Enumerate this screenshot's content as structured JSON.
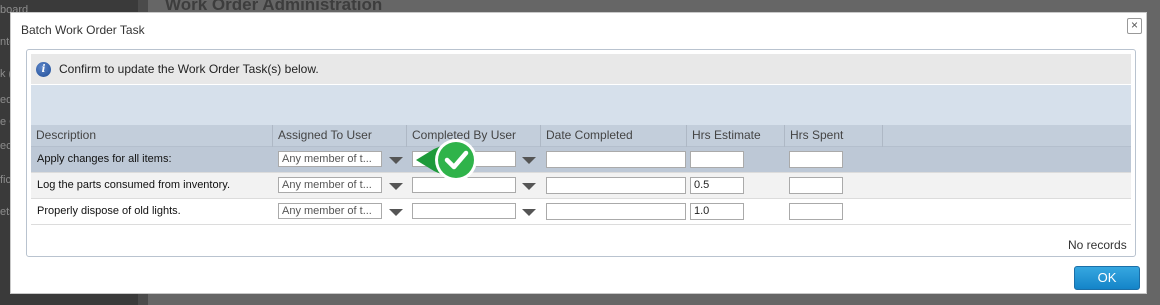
{
  "background": {
    "page_title": "Work Order Administration",
    "sidebar_fragments": [
      "board",
      "nte",
      "k (",
      "edu",
      "e G",
      "ecti",
      "ficat",
      "ets"
    ]
  },
  "dialog": {
    "title": "Batch Work Order Task",
    "close_symbol": "×",
    "message": "Confirm to update the Work Order Task(s) below.",
    "columns": [
      "Description",
      "Assigned To User",
      "Completed By User",
      "Date Completed",
      "Hrs Estimate",
      "Hrs Spent"
    ],
    "rows": [
      {
        "description": "Apply changes for all items:",
        "assigned_to": "Any member of t...",
        "completed_by": "",
        "date_completed": "",
        "hrs_estimate": "",
        "hrs_spent": ""
      },
      {
        "description": "Log the parts consumed from inventory.",
        "assigned_to": "Any member of t...",
        "completed_by": "",
        "date_completed": "",
        "hrs_estimate": "0.5",
        "hrs_spent": ""
      },
      {
        "description": "Properly dispose of old lights.",
        "assigned_to": "Any member of t...",
        "completed_by": "",
        "date_completed": "",
        "hrs_estimate": "1.0",
        "hrs_spent": ""
      }
    ],
    "footer_status": "No records",
    "ok_label": "OK"
  },
  "colors": {
    "ok_button": "#1484c8",
    "header_row": "#c3cedb",
    "selected_row": "#bdc8d6",
    "callout_green": "#2fb34a"
  },
  "icons": {
    "info": "info-icon",
    "dropdown": "chevron-down-icon",
    "callout": "checkmark-callout-icon"
  }
}
